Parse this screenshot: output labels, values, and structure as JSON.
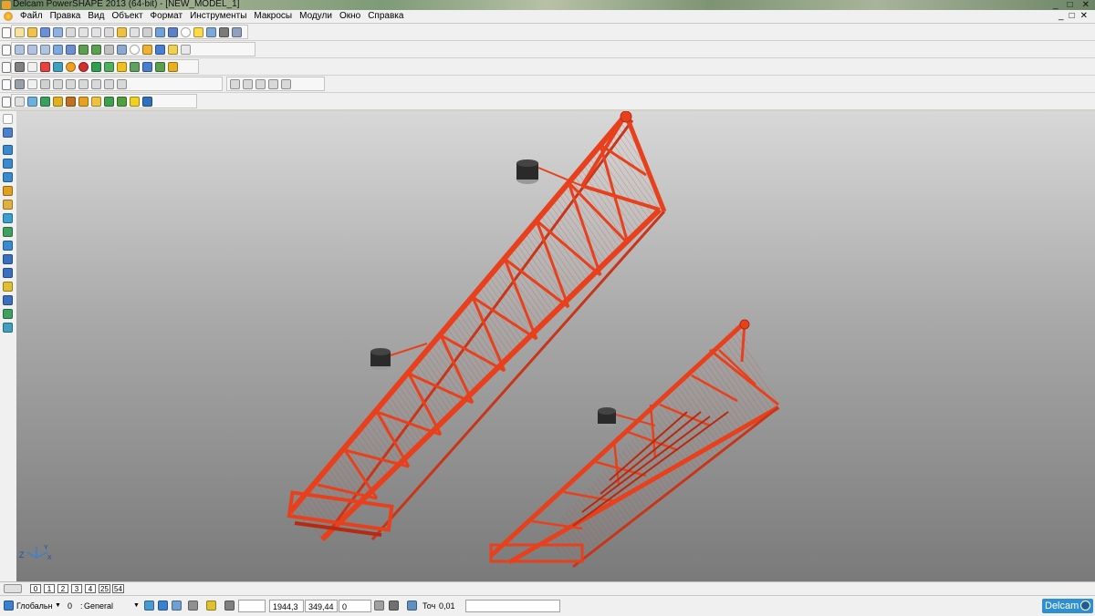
{
  "window": {
    "title": "Delcam PowerSHAPE 2013 (64-bit) - [NEW_MODEL_1]",
    "controls": [
      "_",
      "□",
      "✕"
    ]
  },
  "menu": {
    "items": [
      "Файл",
      "Правка",
      "Вид",
      "Объект",
      "Формат",
      "Инструменты",
      "Макросы",
      "Модули",
      "Окно",
      "Справка"
    ],
    "doc_controls": [
      "_",
      "□",
      "✕"
    ]
  },
  "level_tabs": [
    "0",
    "1",
    "2",
    "3",
    "4",
    "25",
    "54"
  ],
  "status": {
    "workplane": "Глобальн",
    "level_number": "0",
    "level_name": "General",
    "coord_x": "1944,3",
    "coord_y": "349,44",
    "coord_z": "0",
    "tolerance_label": "Точ",
    "tolerance_value": "0,01",
    "brand": "Delcam"
  },
  "axis": {
    "z_label": "Z",
    "x_label": "X",
    "y_label": "Y"
  },
  "colors": {
    "model": "#e8401c",
    "model_dark": "#b52a10",
    "motor": "#2a2a2a"
  }
}
